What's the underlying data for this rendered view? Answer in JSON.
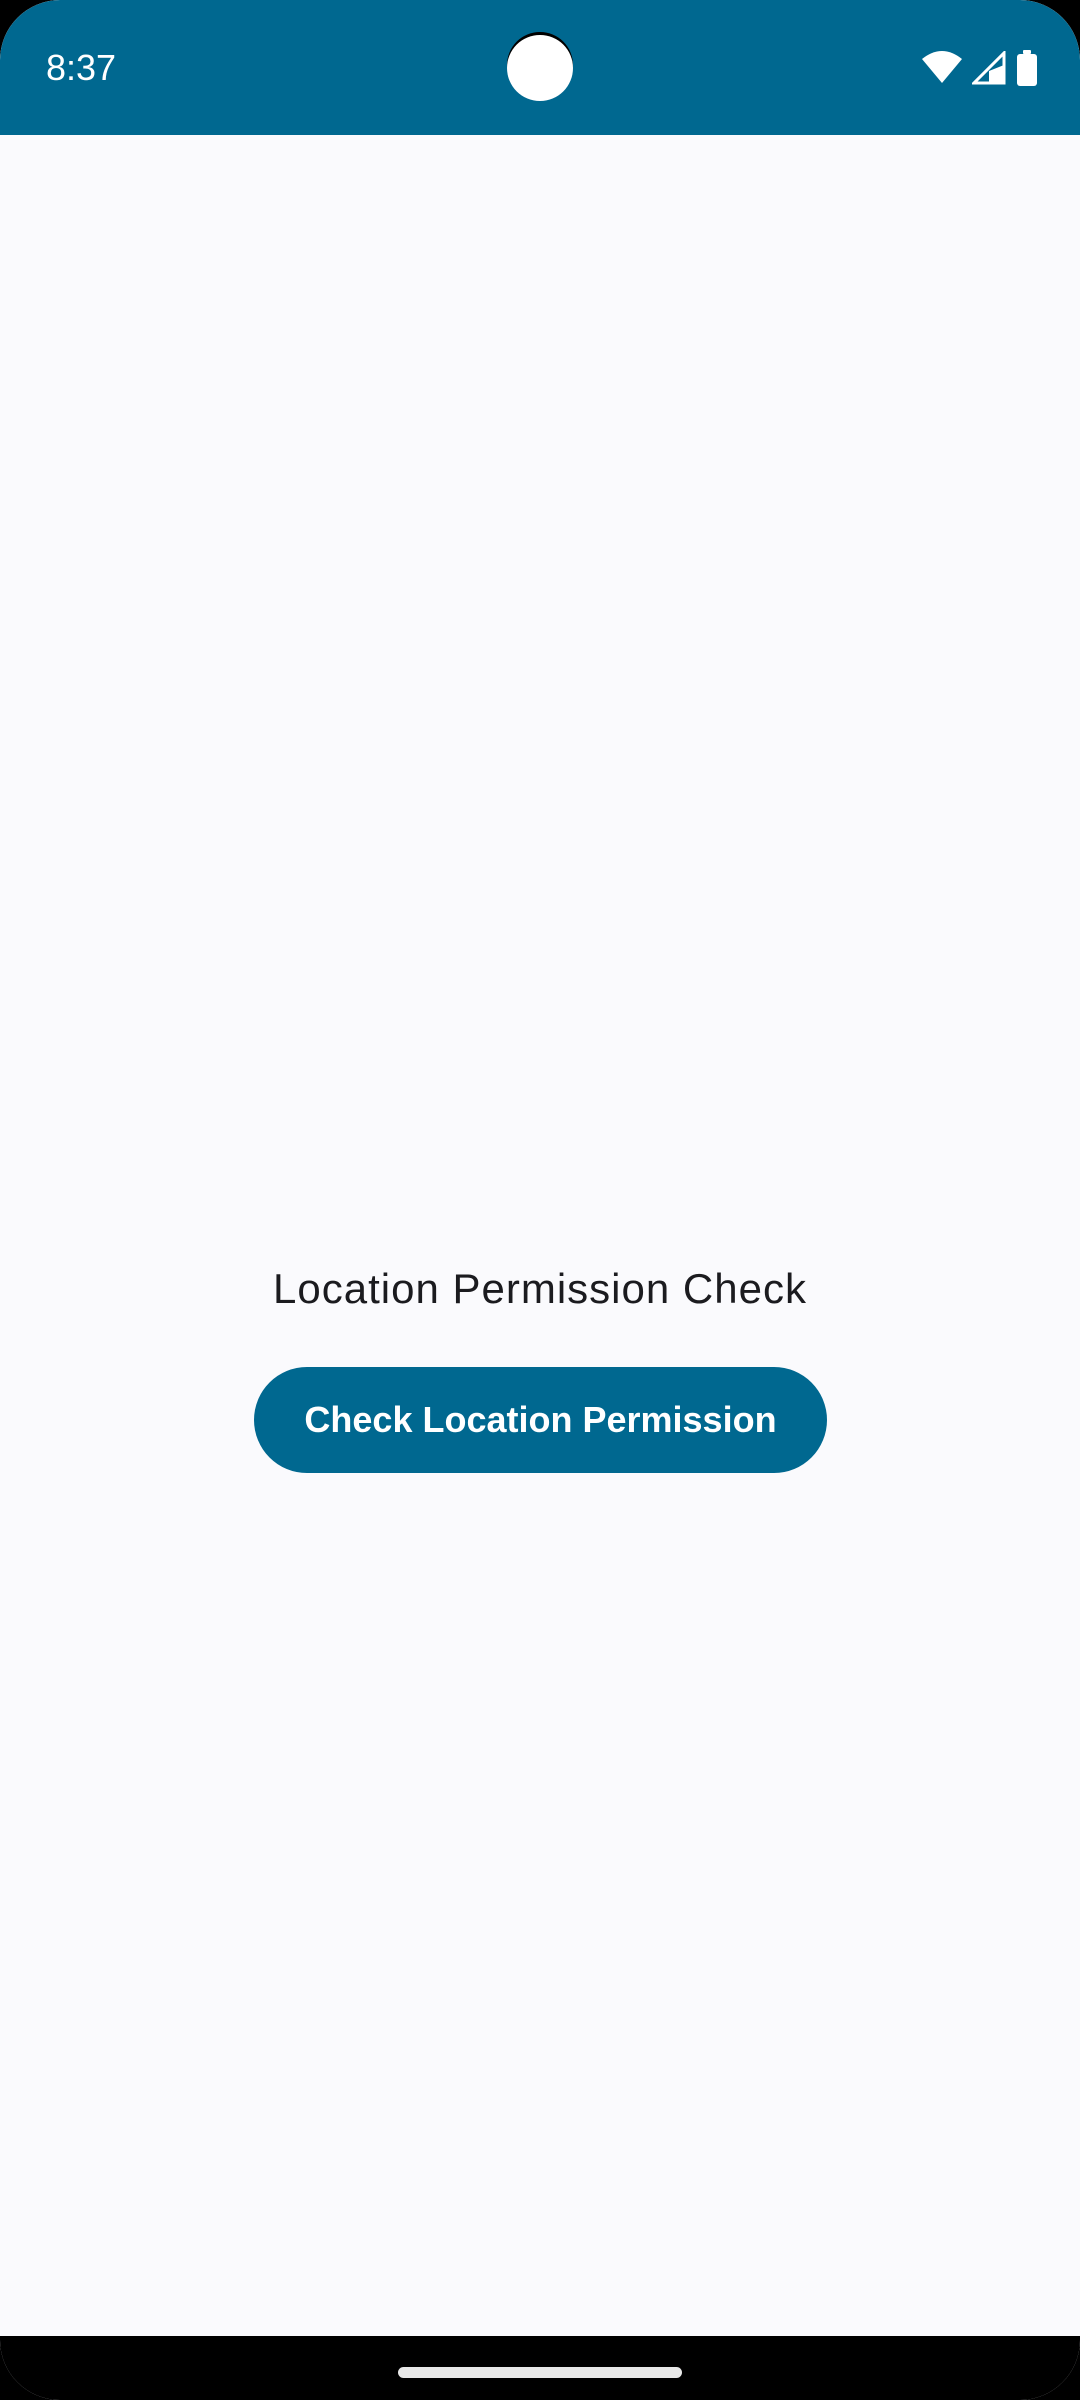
{
  "status_bar": {
    "time": "8:37",
    "icons": [
      "wifi-icon",
      "cellular-signal-icon",
      "battery-icon"
    ],
    "background_color": "#006890"
  },
  "main": {
    "title": "Location Permission Check",
    "button_label": "Check Location Permission",
    "accent_color": "#006890"
  },
  "nav_bar": {
    "gesture": "home-indicator"
  }
}
